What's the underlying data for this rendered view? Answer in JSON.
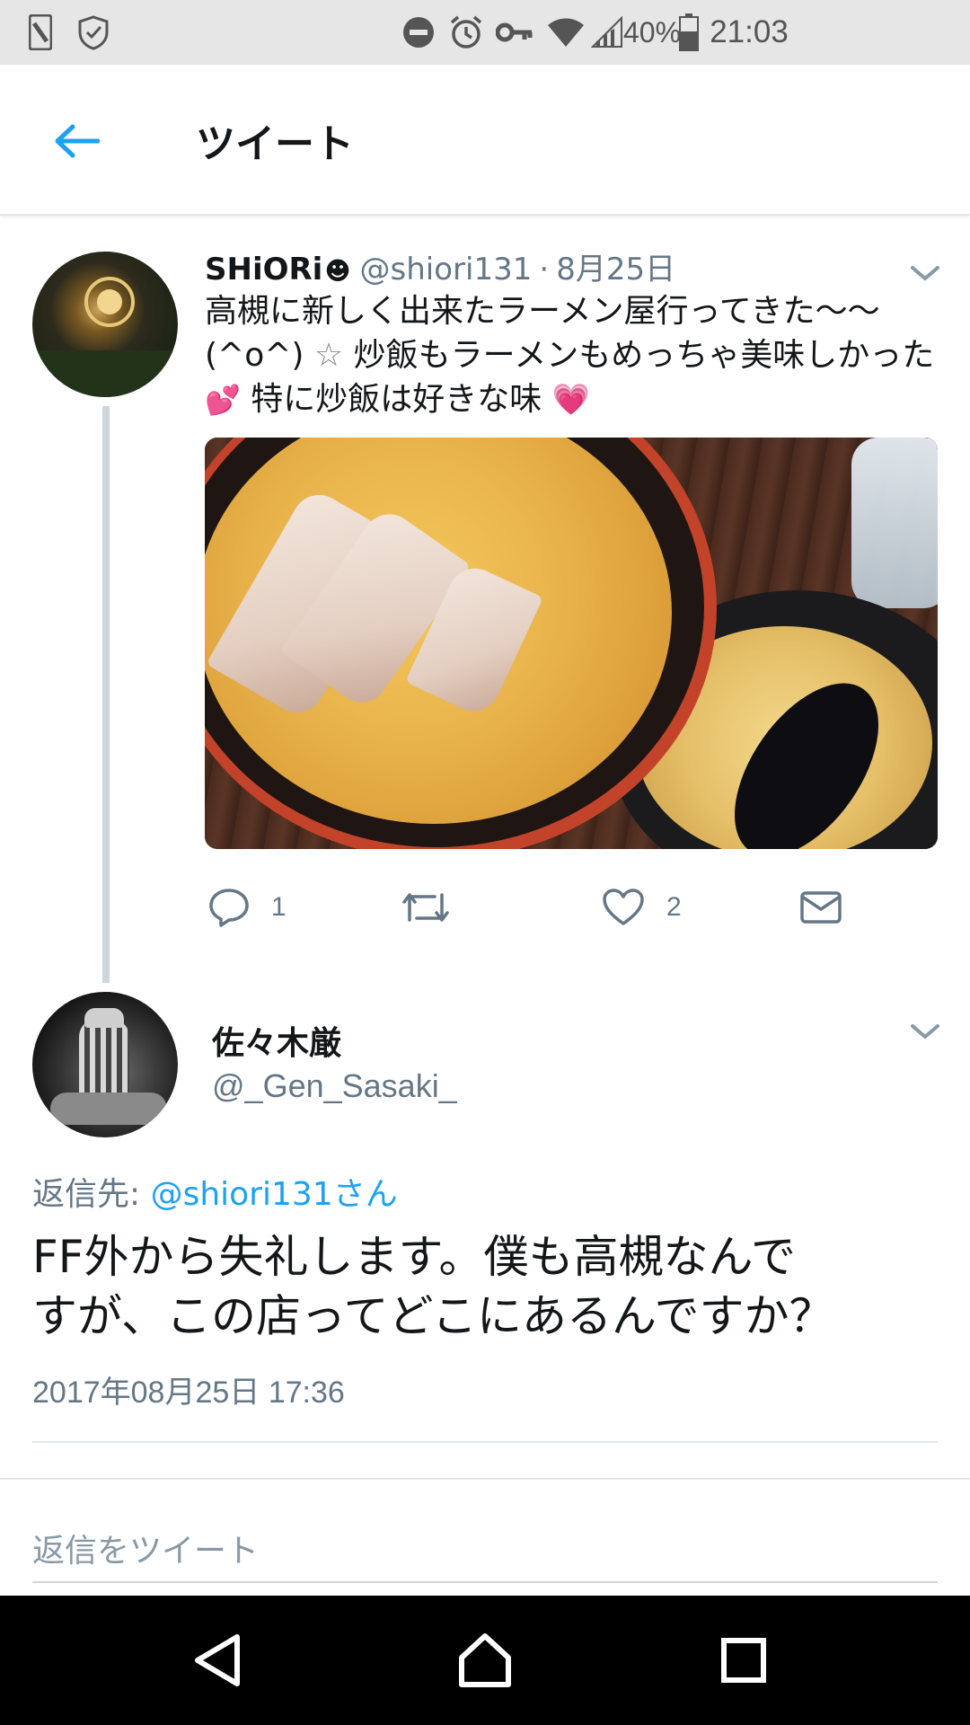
{
  "status_bar": {
    "battery": "40%",
    "time": "21:03",
    "icons": [
      "phone-icon",
      "shield-icon",
      "dnd-icon",
      "alarm-icon",
      "key-icon",
      "wifi-icon",
      "signal-icon",
      "battery-icon"
    ]
  },
  "header": {
    "title": "ツイート",
    "back_icon": "back-arrow-icon"
  },
  "tweet1": {
    "name": "SHiORi",
    "name_emoji": "☻",
    "handle": "@shiori131",
    "separator": "·",
    "date": "8月25日",
    "text_lines": [
      "高槻に新しく出来たラーメン屋行ってきた〜〜",
      "(^o^)",
      "☆",
      "炒飯もラーメンもめっちゃ美味しかった",
      "💕",
      "特に炒飯は好きな味",
      "💗"
    ],
    "photo_alt": "ramen and fried rice photo",
    "actions": {
      "reply_count": "1",
      "retweet_count": "",
      "like_count": "2"
    }
  },
  "tweet2": {
    "name": "佐々木厳",
    "handle": "@_Gen_Sasaki_",
    "reply_prefix": "返信先: ",
    "reply_link": "@shiori131さん",
    "text_lines": [
      "FF外から失礼します。僕も高槻なんで",
      "すが、この店ってどこにあるんですか？"
    ],
    "timestamp": "2017年08月25日 17:36"
  },
  "reply": {
    "placeholder": "返信をツイート"
  },
  "colors": {
    "accent": "#1da1f2",
    "secondary_text": "#657786",
    "divider": "#e1e8ed"
  }
}
